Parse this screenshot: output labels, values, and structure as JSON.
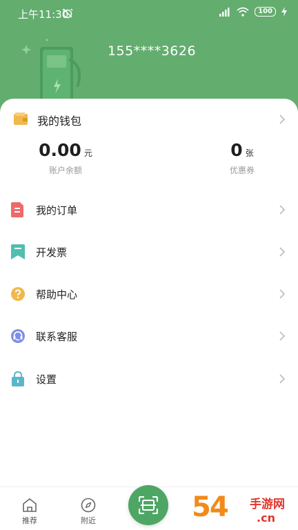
{
  "status_bar": {
    "time": "上午11:30",
    "battery": "100"
  },
  "profile": {
    "phone": "155****3626"
  },
  "wallet": {
    "title": "我的钱包",
    "balance": {
      "value": "0.00",
      "unit": "元",
      "label": "账户余额"
    },
    "coupons": {
      "value": "0",
      "unit": "张",
      "label": "优惠券"
    }
  },
  "menu": [
    {
      "label": "我的订单",
      "icon": "order-icon",
      "color": "#ee6a6a"
    },
    {
      "label": "开发票",
      "icon": "invoice-icon",
      "color": "#4fbfb0"
    },
    {
      "label": "帮助中心",
      "icon": "help-icon",
      "color": "#f0b94b"
    },
    {
      "label": "联系客服",
      "icon": "customer-service-icon",
      "color": "#7f8ee8"
    },
    {
      "label": "设置",
      "icon": "settings-icon",
      "color": "#5bb6c8"
    }
  ],
  "bottom_nav": {
    "recommend": "推荐",
    "nearby": "附近"
  },
  "watermark": {
    "main": "54",
    "side": "手游网",
    "domain": ".cn"
  },
  "colors": {
    "header": "#63ad6f",
    "scan_button": "#4ea664",
    "watermark_orange": "#f28a1a",
    "watermark_red": "#e0342a"
  }
}
